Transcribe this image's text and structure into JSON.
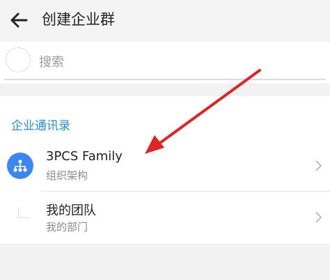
{
  "header": {
    "back_icon": "arrow-left-icon",
    "title": "创建企业群"
  },
  "search": {
    "placeholder": "搜索",
    "icon": "avatar-placeholder-icon"
  },
  "contacts": {
    "section_title": "企业通讯录",
    "items": [
      {
        "title": "3PCS Family",
        "subtitle": "组织架构",
        "icon": "org-chart-icon"
      },
      {
        "title": "我的团队",
        "subtitle": "我的部门",
        "icon": "team-icon"
      }
    ]
  },
  "colors": {
    "accent": "#1f8fe0",
    "org_icon_bg": "#3a86f3",
    "annotation_arrow": "#e02424"
  }
}
